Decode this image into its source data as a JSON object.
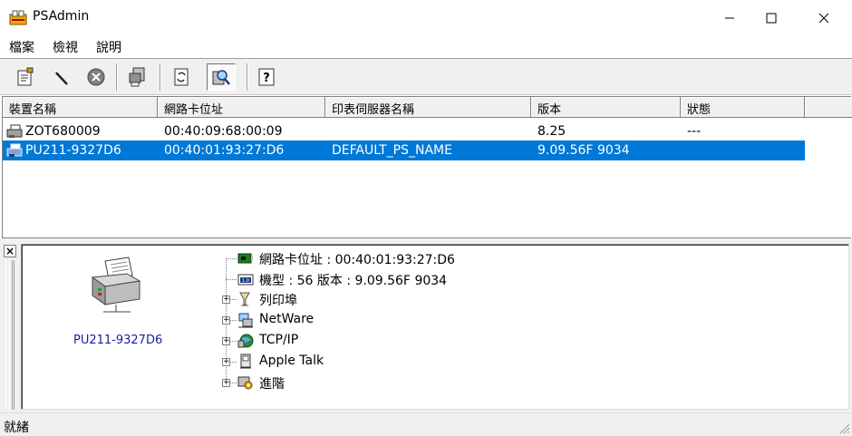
{
  "window": {
    "title": "PSAdmin"
  },
  "menu": {
    "items": [
      "檔案",
      "檢視",
      "說明"
    ]
  },
  "toolbar": {
    "buttons": [
      "properties-icon",
      "wand-icon",
      "delete-icon",
      "printer-server-icon",
      "refresh-icon",
      "search-icon",
      "help-icon"
    ],
    "pressed": "search-icon"
  },
  "list": {
    "columns": [
      "裝置名稱",
      "網路卡位址",
      "印表伺服器名稱",
      "版本",
      "狀態"
    ],
    "rows": [
      {
        "name": "ZOT680009",
        "mac": "00:40:09:68:00:09",
        "server_name": "",
        "version": "8.25",
        "status": "---",
        "selected": false
      },
      {
        "name": "PU211-9327D6",
        "mac": "00:40:01:93:27:D6",
        "server_name": "DEFAULT_PS_NAME",
        "version": "9.09.56F 9034",
        "status": "",
        "selected": true
      }
    ]
  },
  "detail": {
    "close": "×",
    "device_label": "PU211-9327D6",
    "tree": [
      {
        "icon": "network-card-icon",
        "label": "網路卡位址 : 00:40:01:93:27:D6",
        "expandable": false
      },
      {
        "icon": "model-icon",
        "label": "機型 : 56   版本 : 9.09.56F 9034",
        "expandable": false
      },
      {
        "icon": "print-queue-icon",
        "label": "列印埠",
        "expandable": true
      },
      {
        "icon": "netware-icon",
        "label": "NetWare",
        "expandable": true
      },
      {
        "icon": "tcpip-icon",
        "label": "TCP/IP",
        "expandable": true
      },
      {
        "icon": "appletalk-icon",
        "label": "Apple Talk",
        "expandable": true
      },
      {
        "icon": "advanced-icon",
        "label": "進階",
        "expandable": true
      }
    ]
  },
  "status": {
    "text": "就緒"
  },
  "colors": {
    "selection": "#0078d7",
    "device_label": "#1a1aa6"
  }
}
